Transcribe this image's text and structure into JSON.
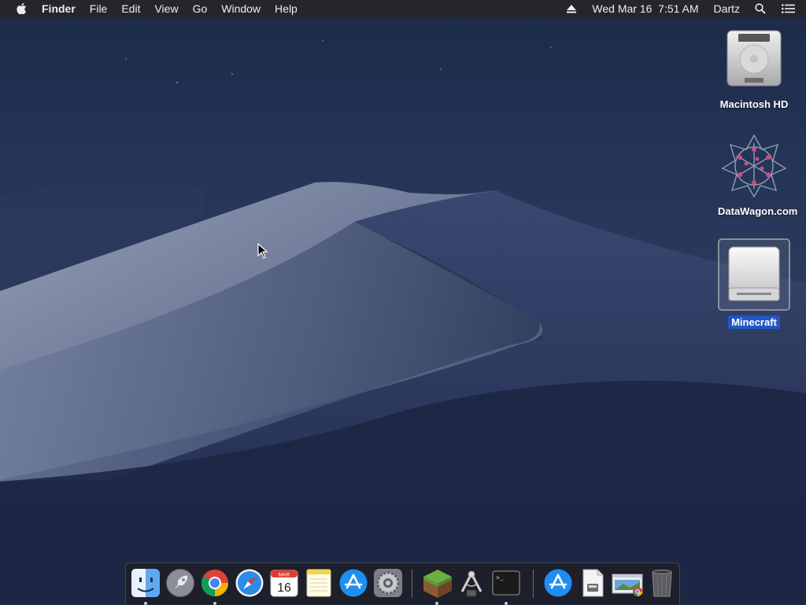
{
  "menubar": {
    "apple_icon": "apple-logo-icon",
    "app_name": "Finder",
    "menus": [
      "File",
      "Edit",
      "View",
      "Go",
      "Window",
      "Help"
    ],
    "eject_icon": "eject-icon",
    "clock": "Wed Mar 16  7:51 AM",
    "user": "Dartz",
    "spotlight_icon": "search-icon",
    "notification_icon": "list-icon"
  },
  "desktop": {
    "icons": [
      {
        "label": "Macintosh HD",
        "icon": "hard-drive-icon",
        "selected": false
      },
      {
        "label": "DataWagon.com",
        "icon": "datawagon-logo-icon",
        "selected": false
      },
      {
        "label": "Minecraft",
        "icon": "external-drive-icon",
        "selected": true
      }
    ]
  },
  "dock": {
    "apps": [
      {
        "name": "Finder",
        "icon": "finder-icon",
        "running": true
      },
      {
        "name": "Launchpad",
        "icon": "rocket-icon",
        "running": false
      },
      {
        "name": "Google Chrome",
        "icon": "chrome-icon",
        "running": true
      },
      {
        "name": "Safari",
        "icon": "compass-icon",
        "running": false
      },
      {
        "name": "Calendar",
        "icon": "calendar-icon",
        "running": false,
        "month": "MAR",
        "day": "16"
      },
      {
        "name": "Notes",
        "icon": "notes-icon",
        "running": false
      },
      {
        "name": "App Store",
        "icon": "app-store-icon",
        "running": false
      },
      {
        "name": "System Preferences",
        "icon": "gear-icon",
        "running": false
      },
      {
        "name": "Minecraft",
        "icon": "grass-block-icon",
        "running": true
      },
      {
        "name": "Instruments",
        "icon": "caliper-icon",
        "running": false
      },
      {
        "name": "Terminal",
        "icon": "terminal-icon",
        "running": true,
        "prompt": ">_"
      },
      {
        "name": "Downloads",
        "icon": "app-store-folder-icon",
        "running": false
      },
      {
        "name": "Document",
        "icon": "document-icon",
        "running": false
      },
      {
        "name": "Chrome Apps",
        "icon": "chrome-window-icon",
        "running": false
      },
      {
        "name": "Trash",
        "icon": "trash-icon",
        "running": false
      }
    ]
  },
  "colors": {
    "menubar_bg": "#26262a",
    "selection_blue": "#1f57c9",
    "wallpaper_sky": "#243456"
  }
}
